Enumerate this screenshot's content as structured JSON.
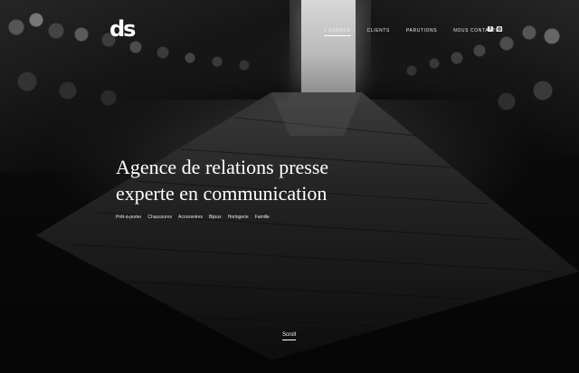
{
  "header": {
    "logo_text": "ds",
    "nav": [
      {
        "label": "L'AGENCE",
        "active": true
      },
      {
        "label": "CLIENTS",
        "active": false
      },
      {
        "label": "PARUTIONS",
        "active": false
      },
      {
        "label": "NOUS CONTACTER",
        "active": false
      }
    ],
    "social": [
      {
        "icon": "facebook-icon",
        "glyph": "f"
      },
      {
        "icon": "instagram-icon",
        "glyph": "◎"
      }
    ]
  },
  "hero": {
    "headline_line1": "Agence de relations presse",
    "headline_line2": "experte en communication",
    "categories": [
      "Prêt-à-porter",
      "Chaussures",
      "Accessoires",
      "Bijoux",
      "Horlogerie",
      "Famille"
    ],
    "scroll_label": "Scroll"
  },
  "colors": {
    "background": "#000000",
    "text": "#ffffff"
  }
}
